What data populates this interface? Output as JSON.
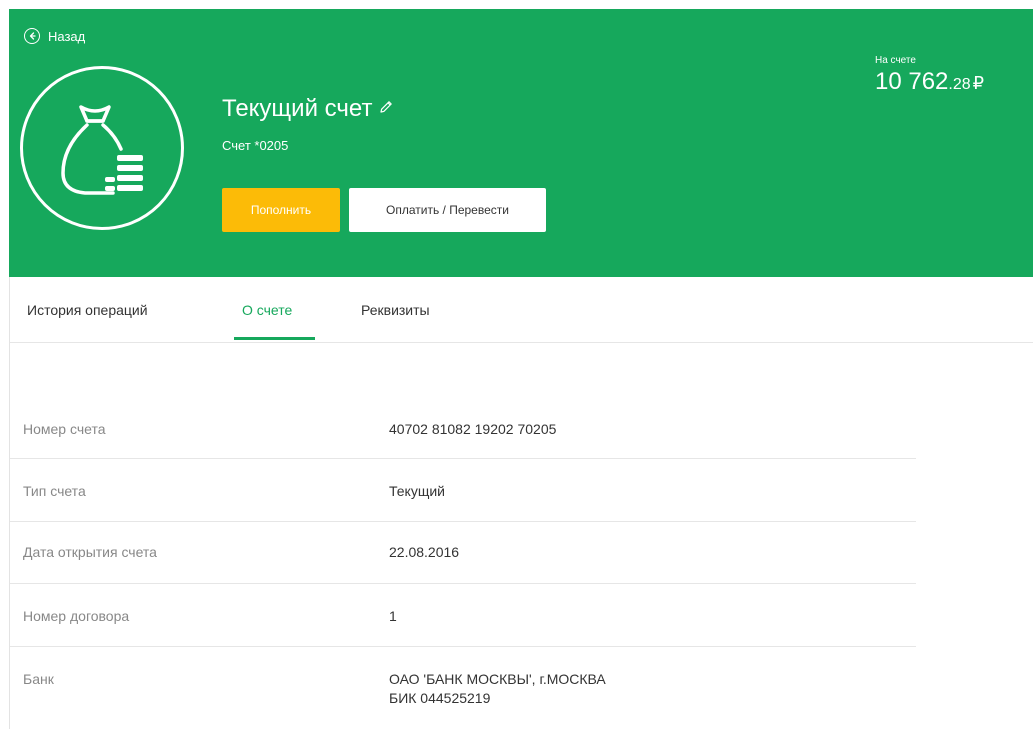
{
  "header": {
    "back_label": "Назад",
    "title": "Текущий счет",
    "account_short": "Счет *0205",
    "topup_label": "Пополнить",
    "pay_label": "Оплатить / Перевести",
    "balance_label": "На счете",
    "balance_integer": "10 762",
    "balance_fraction": ".28",
    "balance_currency": "₽"
  },
  "tabs": [
    {
      "label": "История операций"
    },
    {
      "label": "О счете",
      "active": true
    },
    {
      "label": "Реквизиты"
    }
  ],
  "details": {
    "account_number": {
      "label": "Номер счета",
      "value": "40702 81082 19202 70205"
    },
    "account_type": {
      "label": "Тип счета",
      "value": "Текущий"
    },
    "open_date": {
      "label": "Дата открытия счета",
      "value": "22.08.2016"
    },
    "contract_number": {
      "label": "Номер договора",
      "value": "1"
    },
    "bank": {
      "label": "Банк",
      "value": "ОАО 'БАНК МОСКВЫ', г.МОСКВА",
      "value2": "БИК 044525219"
    }
  },
  "colors": {
    "brand_green": "#16a85c",
    "accent_yellow": "#fcbb07"
  },
  "icons": {
    "back": "arrow-left-circle-icon",
    "edit": "pencil-icon",
    "account": "money-bag-coins-icon"
  }
}
